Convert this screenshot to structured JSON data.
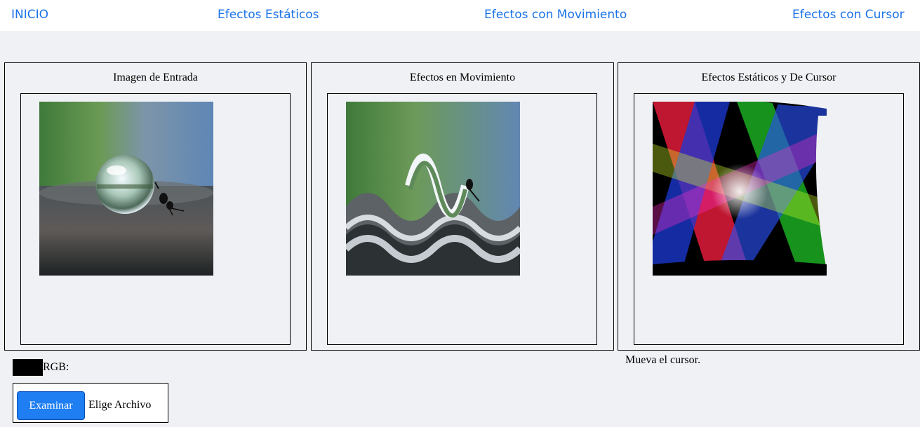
{
  "nav": {
    "home": "INICIO",
    "static": "Efectos Estáticos",
    "moving": "Efectos con Movimiento",
    "cursor": "Efectos con Cursor"
  },
  "panels": [
    {
      "title": "Imagen de Entrada"
    },
    {
      "title": "Efectos en Movimiento"
    },
    {
      "title": "Efectos Estáticos y De Cursor"
    }
  ],
  "rgb": {
    "label": "RGB:",
    "swatch_color": "#000000"
  },
  "cursor_hint": "Mueva el cursor.",
  "file": {
    "button_label": "Examinar",
    "status": "Elige Archivo"
  },
  "colors": {
    "accent": "#1a73e8",
    "button": "#1e7ef2",
    "background": "#f0f1f4"
  }
}
